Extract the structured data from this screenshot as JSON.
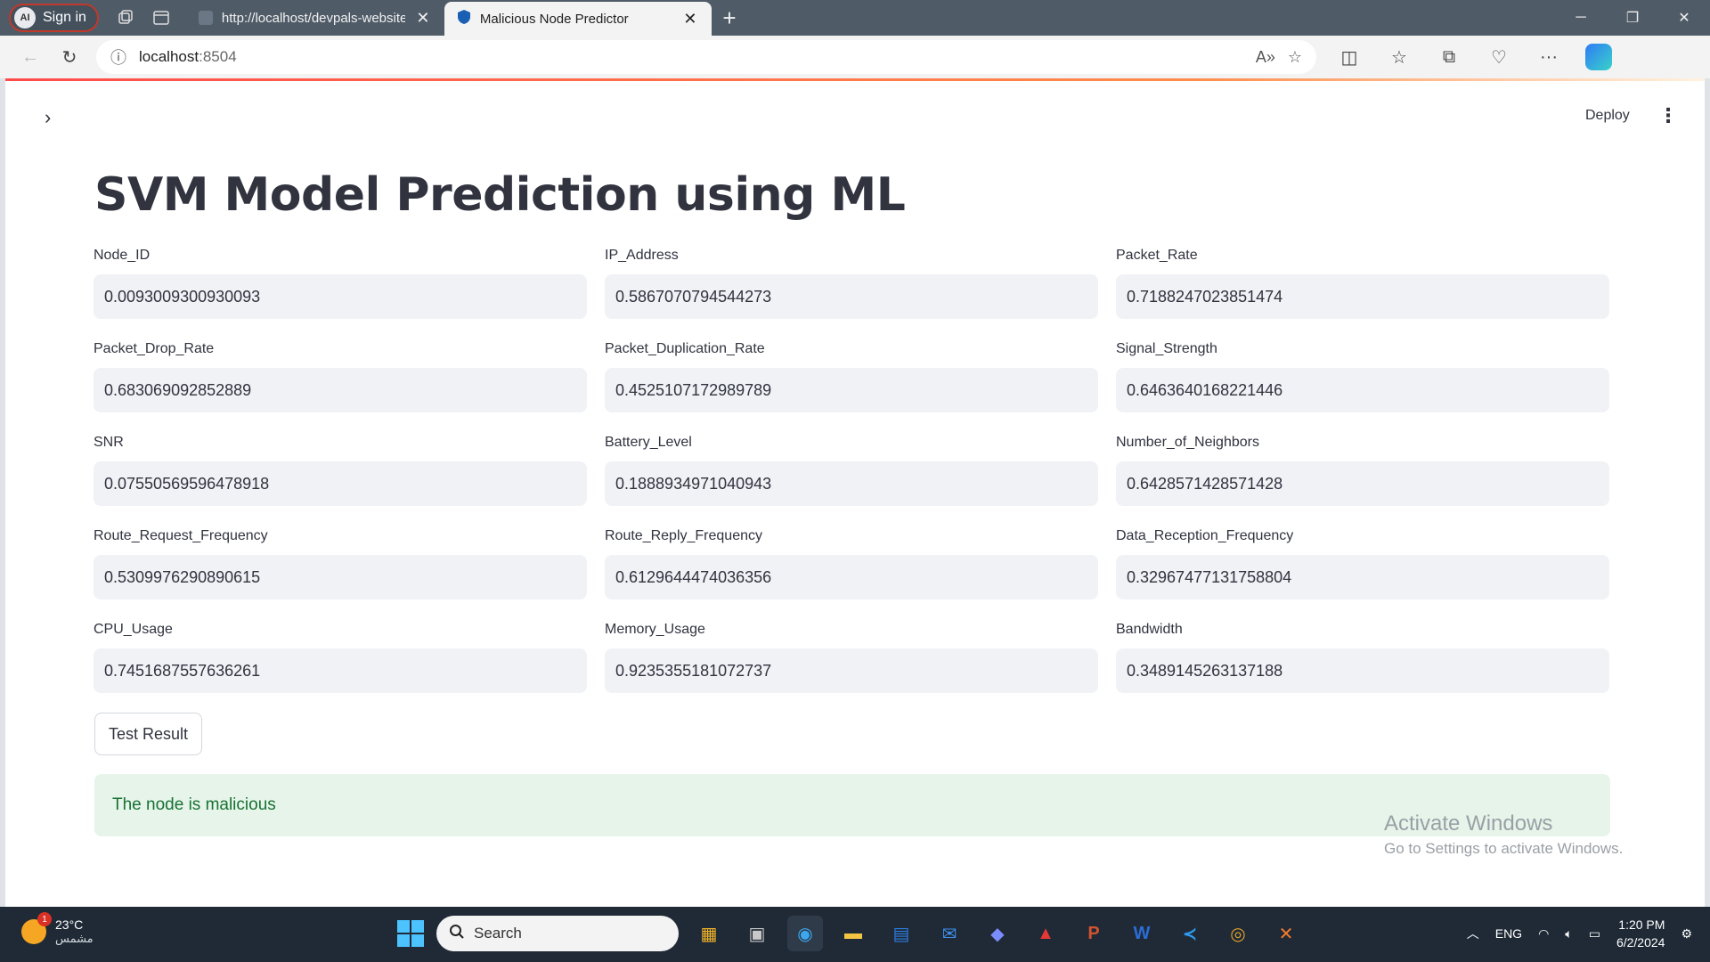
{
  "browser": {
    "profile_label": "Sign in",
    "profile_initials": "AI",
    "tabs": [
      {
        "title": "http://localhost/devpals-website",
        "active": false
      },
      {
        "title": "Malicious Node Predictor",
        "active": true
      }
    ],
    "url_host": "localhost",
    "url_port": ":8504"
  },
  "app": {
    "deploy_label": "Deploy",
    "title": "SVM Model Prediction using ML",
    "fields": [
      {
        "label": "Node_ID",
        "value": "0.0093009300930093"
      },
      {
        "label": "IP_Address",
        "value": "0.5867070794544273"
      },
      {
        "label": "Packet_Rate",
        "value": "0.7188247023851474"
      },
      {
        "label": "Packet_Drop_Rate",
        "value": "0.683069092852889"
      },
      {
        "label": "Packet_Duplication_Rate",
        "value": "0.4525107172989789"
      },
      {
        "label": "Signal_Strength",
        "value": "0.6463640168221446"
      },
      {
        "label": "SNR",
        "value": "0.07550569596478918"
      },
      {
        "label": "Battery_Level",
        "value": "0.1888934971040943"
      },
      {
        "label": "Number_of_Neighbors",
        "value": "0.6428571428571428"
      },
      {
        "label": "Route_Request_Frequency",
        "value": "0.5309976290890615"
      },
      {
        "label": "Route_Reply_Frequency",
        "value": "0.6129644474036356"
      },
      {
        "label": "Data_Reception_Frequency",
        "value": "0.32967477131758804"
      },
      {
        "label": "CPU_Usage",
        "value": "0.7451687557636261"
      },
      {
        "label": "Memory_Usage",
        "value": "0.9235355181072737"
      },
      {
        "label": "Bandwidth",
        "value": "0.3489145263137188"
      }
    ],
    "button_label": "Test Result",
    "result_text": "The node is malicious"
  },
  "watermark": {
    "line1": "Activate Windows",
    "line2": "Go to Settings to activate Windows."
  },
  "taskbar": {
    "weather_temp": "23°C",
    "weather_desc": "مشمس",
    "notification_count": "1",
    "search_placeholder": "Search",
    "language": "ENG",
    "time": "1:20 PM",
    "date": "6/2/2024"
  },
  "colors": {
    "accent_red": "#ff4b4b",
    "success_bg": "#e6f4ea",
    "success_text": "#177233",
    "input_bg": "#f0f2f6"
  }
}
